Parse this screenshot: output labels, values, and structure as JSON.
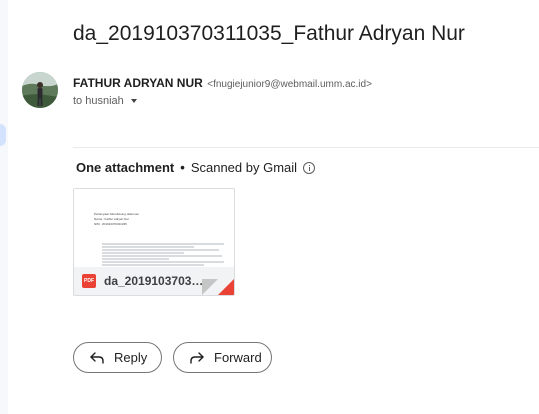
{
  "email": {
    "subject": "da_201910370311035_Fathur Adryan Nur",
    "sender": {
      "name": "FATHUR ADRYAN NUR",
      "email": "<fnugiejunior9@webmail.umm.ac.id>"
    },
    "recipient": "to husniah"
  },
  "attachments": {
    "count_label": "One attachment",
    "separator": "•",
    "scan_label": "Scanned by Gmail",
    "items": [
      {
        "type_label": "PDF",
        "filename": "da_201910370311035_Fathur Adryan Nur.pdf",
        "filename_display": "da_201910370311...",
        "preview_lines": [
          "Pertanyaan Mendukung dokumen",
          "Nama    : Fathur Adryan Nur",
          "NIM     : 201910370311035"
        ]
      }
    ]
  },
  "actions": {
    "reply_label": "Reply",
    "forward_label": "Forward"
  },
  "colors": {
    "pdf_red": "#ea4335",
    "button_border": "#747775",
    "rail_accent": "#d3e3fd"
  }
}
